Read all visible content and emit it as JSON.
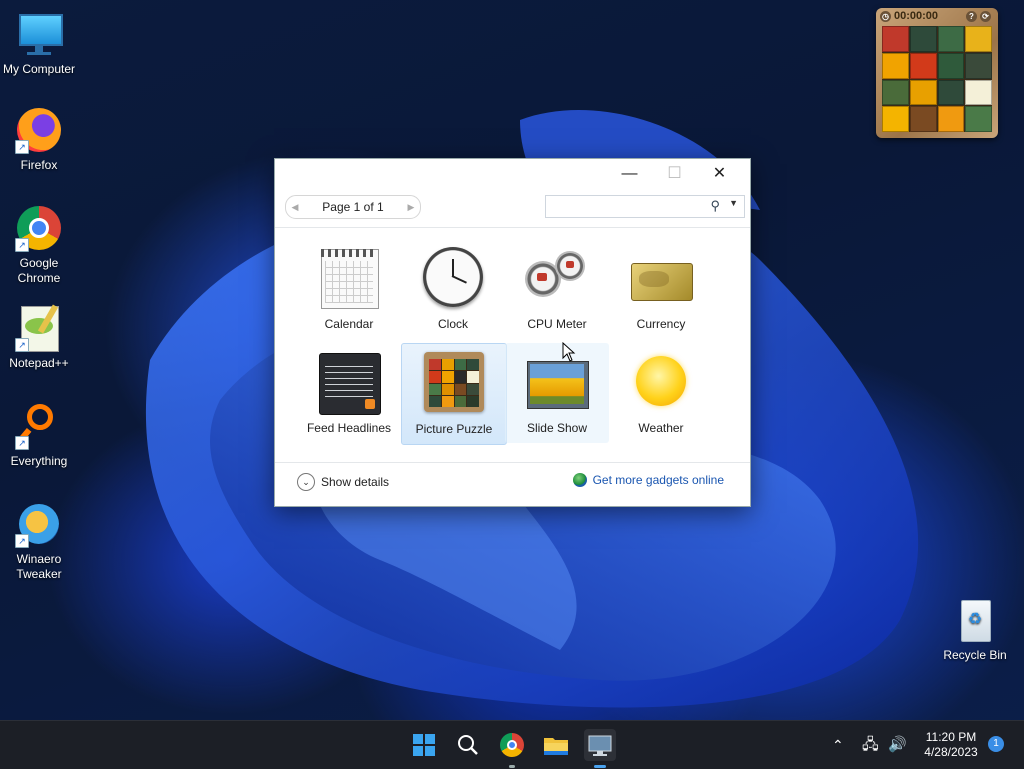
{
  "desktop": {
    "icons": [
      {
        "label": "My Computer"
      },
      {
        "label": "Firefox"
      },
      {
        "label": "Google Chrome"
      },
      {
        "label": "Notepad++"
      },
      {
        "label": "Everything"
      },
      {
        "label": "Winaero Tweaker"
      },
      {
        "label": "Recycle Bin"
      }
    ]
  },
  "puzzle_gadget": {
    "timer": "00:00:00"
  },
  "dialog": {
    "pager_label": "Page 1 of 1",
    "search_placeholder": "",
    "gadgets": [
      {
        "label": "Calendar"
      },
      {
        "label": "Clock"
      },
      {
        "label": "CPU Meter"
      },
      {
        "label": "Currency"
      },
      {
        "label": "Feed Headlines"
      },
      {
        "label": "Picture Puzzle"
      },
      {
        "label": "Slide Show"
      },
      {
        "label": "Weather"
      }
    ],
    "selected_gadget": "Picture Puzzle",
    "show_details": "Show details",
    "get_more": "Get more gadgets online"
  },
  "taskbar": {
    "time": "11:20 PM",
    "date": "4/28/2023",
    "notification_count": "1"
  },
  "colors": {
    "accent": "#1a56b0",
    "taskbar": "#1c1f26"
  }
}
